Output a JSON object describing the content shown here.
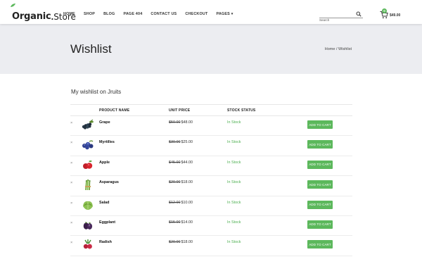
{
  "header": {
    "logo_brand": "Organic",
    "logo_dot": ".",
    "logo_store": "Store",
    "nav": [
      "HOME",
      "SHOP",
      "BLOG",
      "PAGE 404",
      "CONTACT US",
      "CHECKOUT",
      "PAGES"
    ],
    "search_placeholder": "Search",
    "cart_count": "0",
    "cart_total": "$49.00"
  },
  "banner": {
    "title": "Wishlist",
    "crumb_home": "Home",
    "crumb_sep": " / ",
    "crumb_current": "Wishlist"
  },
  "main": {
    "subtitle": "My wishlist on Jruits",
    "columns": {
      "product": "PRODUCT NAME",
      "price": "UNIT PRICE",
      "stock": "STOCK STATUS"
    },
    "remove_symbol": "×",
    "add_label": "ADD TO CART",
    "rows": [
      {
        "name": "Grape",
        "old": "$50.00",
        "price": "$48.00",
        "stock": "In Stock",
        "icon": "grape-icon"
      },
      {
        "name": "Myrtilles",
        "old": "$30.00",
        "price": "$25.00",
        "stock": "In Stock",
        "icon": "blueberry-icon"
      },
      {
        "name": "Apple",
        "old": "$45.00",
        "price": "$44.00",
        "stock": "In Stock",
        "icon": "apple-icon"
      },
      {
        "name": "Asparagus",
        "old": "$20.00",
        "price": "$18.00",
        "stock": "In Stock",
        "icon": "asparagus-icon"
      },
      {
        "name": "Salad",
        "old": "$12.00",
        "price": "$10.00",
        "stock": "In Stock",
        "icon": "salad-icon"
      },
      {
        "name": "Eggplant",
        "old": "$15.00",
        "price": "$14.00",
        "stock": "In Stock",
        "icon": "eggplant-icon"
      },
      {
        "name": "Radish",
        "old": "$20.00",
        "price": "$18.00",
        "stock": "In Stock",
        "icon": "radish-icon"
      }
    ]
  },
  "colors": {
    "accent": "#5cb85c",
    "banner_bg": "#ecedf1",
    "stock_text": "#4caf50"
  }
}
